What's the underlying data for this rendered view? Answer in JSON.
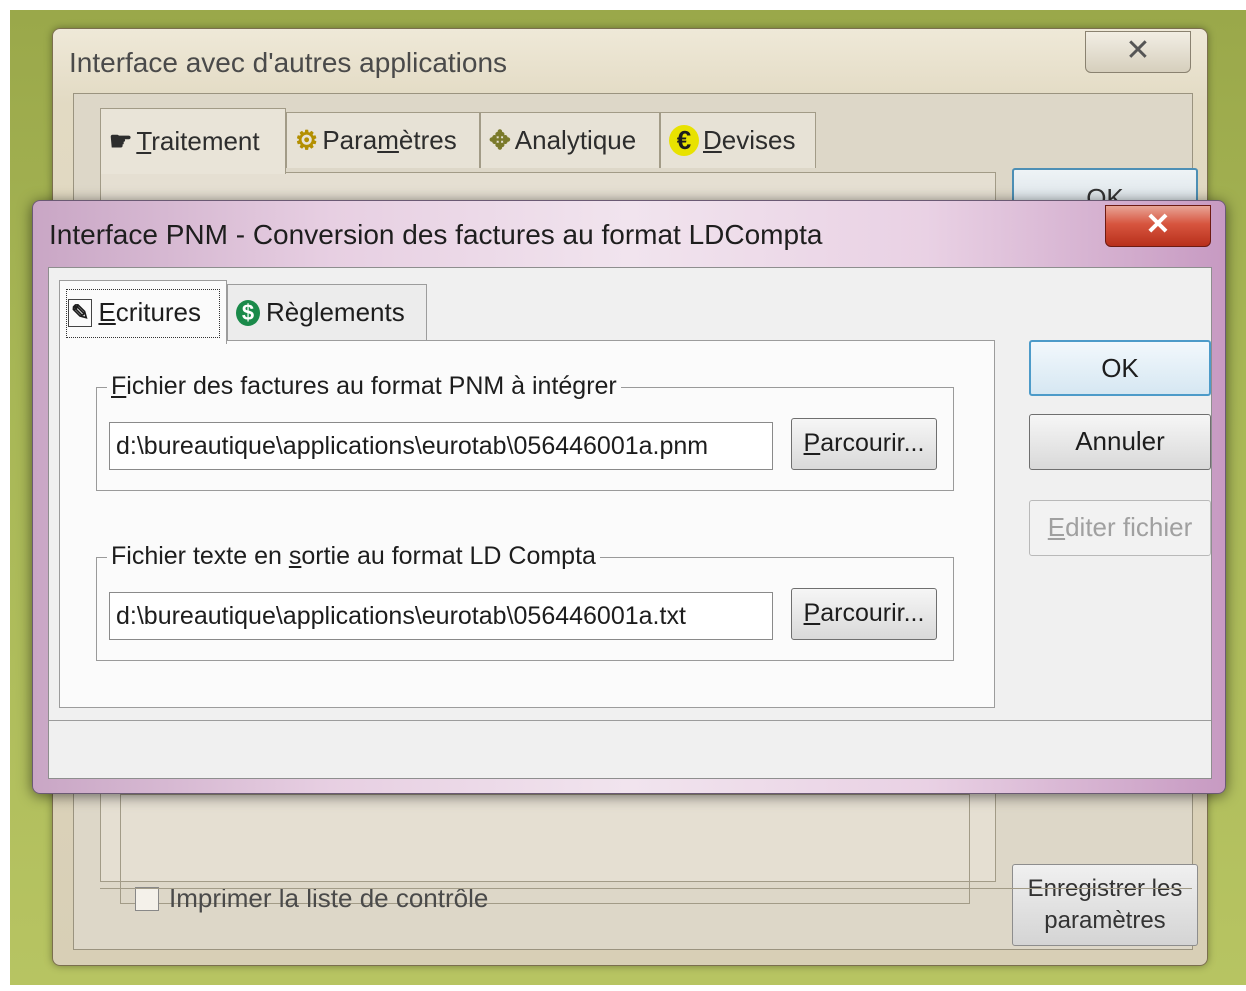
{
  "back_window": {
    "title": "Interface avec d'autres applications",
    "close_glyph": "✕",
    "tabs": [
      {
        "pre": "",
        "key": "T",
        "post": "raitement",
        "icon": "hand-icon",
        "glyph": "☛"
      },
      {
        "pre": "Para",
        "key": "m",
        "post": "ètres",
        "icon": "gear-icon",
        "glyph": "⚙"
      },
      {
        "pre": "",
        "key": "",
        "post": "Analytique",
        "icon": "move-icon",
        "glyph": "✥"
      },
      {
        "pre": "",
        "key": "D",
        "post": "evises",
        "icon": "euro-icon",
        "glyph": "€"
      }
    ],
    "ok_label": "OK",
    "checkbox_label": "Imprimer la liste de contrôle",
    "save_button": {
      "line1": "Enregistrer les",
      "line2": "paramètres"
    }
  },
  "front_window": {
    "title": "Interface PNM - Conversion des factures au format LDCompta",
    "close_glyph": "✕",
    "tabs": [
      {
        "key": "E",
        "post": "critures",
        "icon": "document-edit-icon",
        "glyph": "✎"
      },
      {
        "pre": "Règlements",
        "icon": "dollar-icon",
        "glyph": "$"
      }
    ],
    "group_input": {
      "legend_key": "F",
      "legend_rest": "ichier des factures au format PNM à intégrer",
      "value": "d:\\bureautique\\applications\\eurotab\\056446001a.pnm"
    },
    "group_output": {
      "legend_pre": "Fichier texte en ",
      "legend_key": "s",
      "legend_rest": "ortie au format LD Compta",
      "value": "d:\\bureautique\\applications\\eurotab\\056446001a.txt"
    },
    "browse_key": "P",
    "browse_rest": "arcourir...",
    "buttons": {
      "ok": "OK",
      "cancel": "Annuler",
      "edit_key": "E",
      "edit_rest": "diter fichier"
    }
  },
  "colors": {
    "desktop": "#a8b756",
    "close_red": "#c7402a",
    "ok_border": "#4d9bc9"
  }
}
